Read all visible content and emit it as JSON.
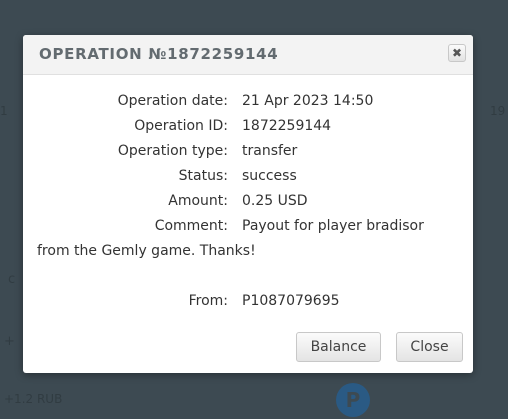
{
  "background": {
    "left_text_1": "1",
    "right_text_1": "19",
    "left_text_2": "c",
    "left_text_3": "+",
    "left_text_4": "+1.2 RUB",
    "circle_letter": "P"
  },
  "dialog": {
    "title": "OPERATION №1872259144",
    "close_glyph": "✖",
    "fields": {
      "operation_date": {
        "label": "Operation date:",
        "value": "21 Apr 2023 14:50"
      },
      "operation_id": {
        "label": "Operation ID:",
        "value": "1872259144"
      },
      "operation_type": {
        "label": "Operation type:",
        "value": "transfer"
      },
      "status": {
        "label": "Status:",
        "value": "success"
      },
      "amount": {
        "label": "Amount:",
        "value": "0.25 USD"
      },
      "comment": {
        "label": "Comment:",
        "value_line_1": "Payout for player bradisor",
        "value_line_2": "from the Gemly game. Thanks!"
      },
      "from": {
        "label": "From:",
        "value": "P1087079695"
      }
    },
    "buttons": {
      "balance": "Balance",
      "close": "Close"
    }
  }
}
